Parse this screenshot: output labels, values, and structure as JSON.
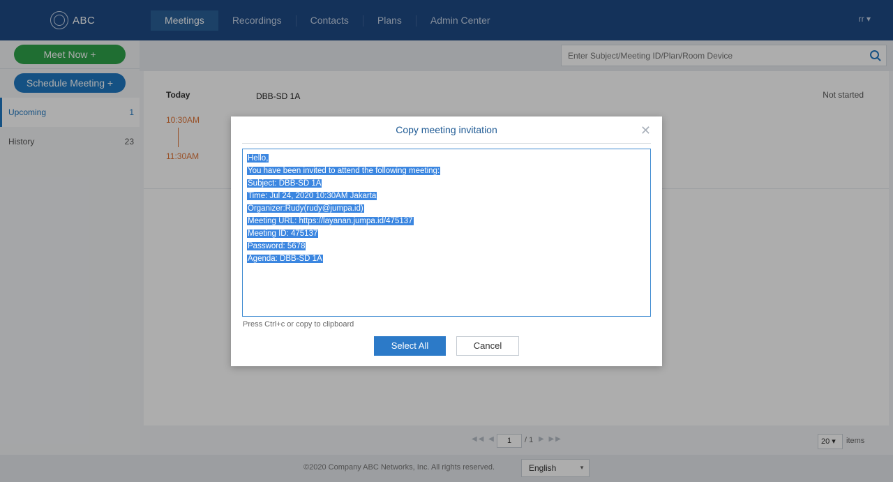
{
  "header": {
    "logo_text": "ABC",
    "logo_small": "LOGO",
    "nav": [
      {
        "label": "Meetings",
        "active": true
      },
      {
        "label": "Recordings",
        "active": false
      },
      {
        "label": "Contacts",
        "active": false
      },
      {
        "label": "Plans",
        "active": false
      },
      {
        "label": "Admin Center",
        "active": false
      }
    ],
    "user": "rr ▾"
  },
  "sidebar": {
    "meet_now": "Meet Now +",
    "schedule": "Schedule Meeting +",
    "items": [
      {
        "label": "Upcoming",
        "count": "1",
        "active": true
      },
      {
        "label": "History",
        "count": "23",
        "active": false
      }
    ]
  },
  "search": {
    "placeholder": "Enter Subject/Meeting ID/Plan/Room Device"
  },
  "schedule_list": {
    "day": "Today",
    "start": "10:30AM",
    "end": "11:30AM",
    "title": "DBB-SD 1A",
    "status": "Not started"
  },
  "pagination": {
    "page": "1",
    "total": "/ 1",
    "page_size": "20 ▾",
    "items_label": "items"
  },
  "footer": {
    "copyright": "©2020 Company ABC Networks, Inc. All rights reserved.",
    "language": "English"
  },
  "modal": {
    "title": "Copy meeting invitation",
    "lines": [
      "Hello,",
      "You have been invited to attend the following meeting:",
      "Subject: DBB-SD 1A",
      "Time: Jul 24, 2020 10:30AM Jakarta",
      "Organizer:Rudy(rudy@jumpa.id)",
      "Meeting URL: https://layanan.jumpa.id/475137",
      "Meeting ID: 475137",
      "Password: 5678",
      "Agenda: DBB-SD 1A"
    ],
    "hint": "Press Ctrl+c or copy to clipboard",
    "select_all": "Select All",
    "cancel": "Cancel"
  },
  "colors": {
    "header_bg": "#1e4b85",
    "meet_now": "#2ea34a",
    "schedule": "#1f78c1",
    "time_accent": "#e0763a",
    "selection": "#3b86e0"
  }
}
